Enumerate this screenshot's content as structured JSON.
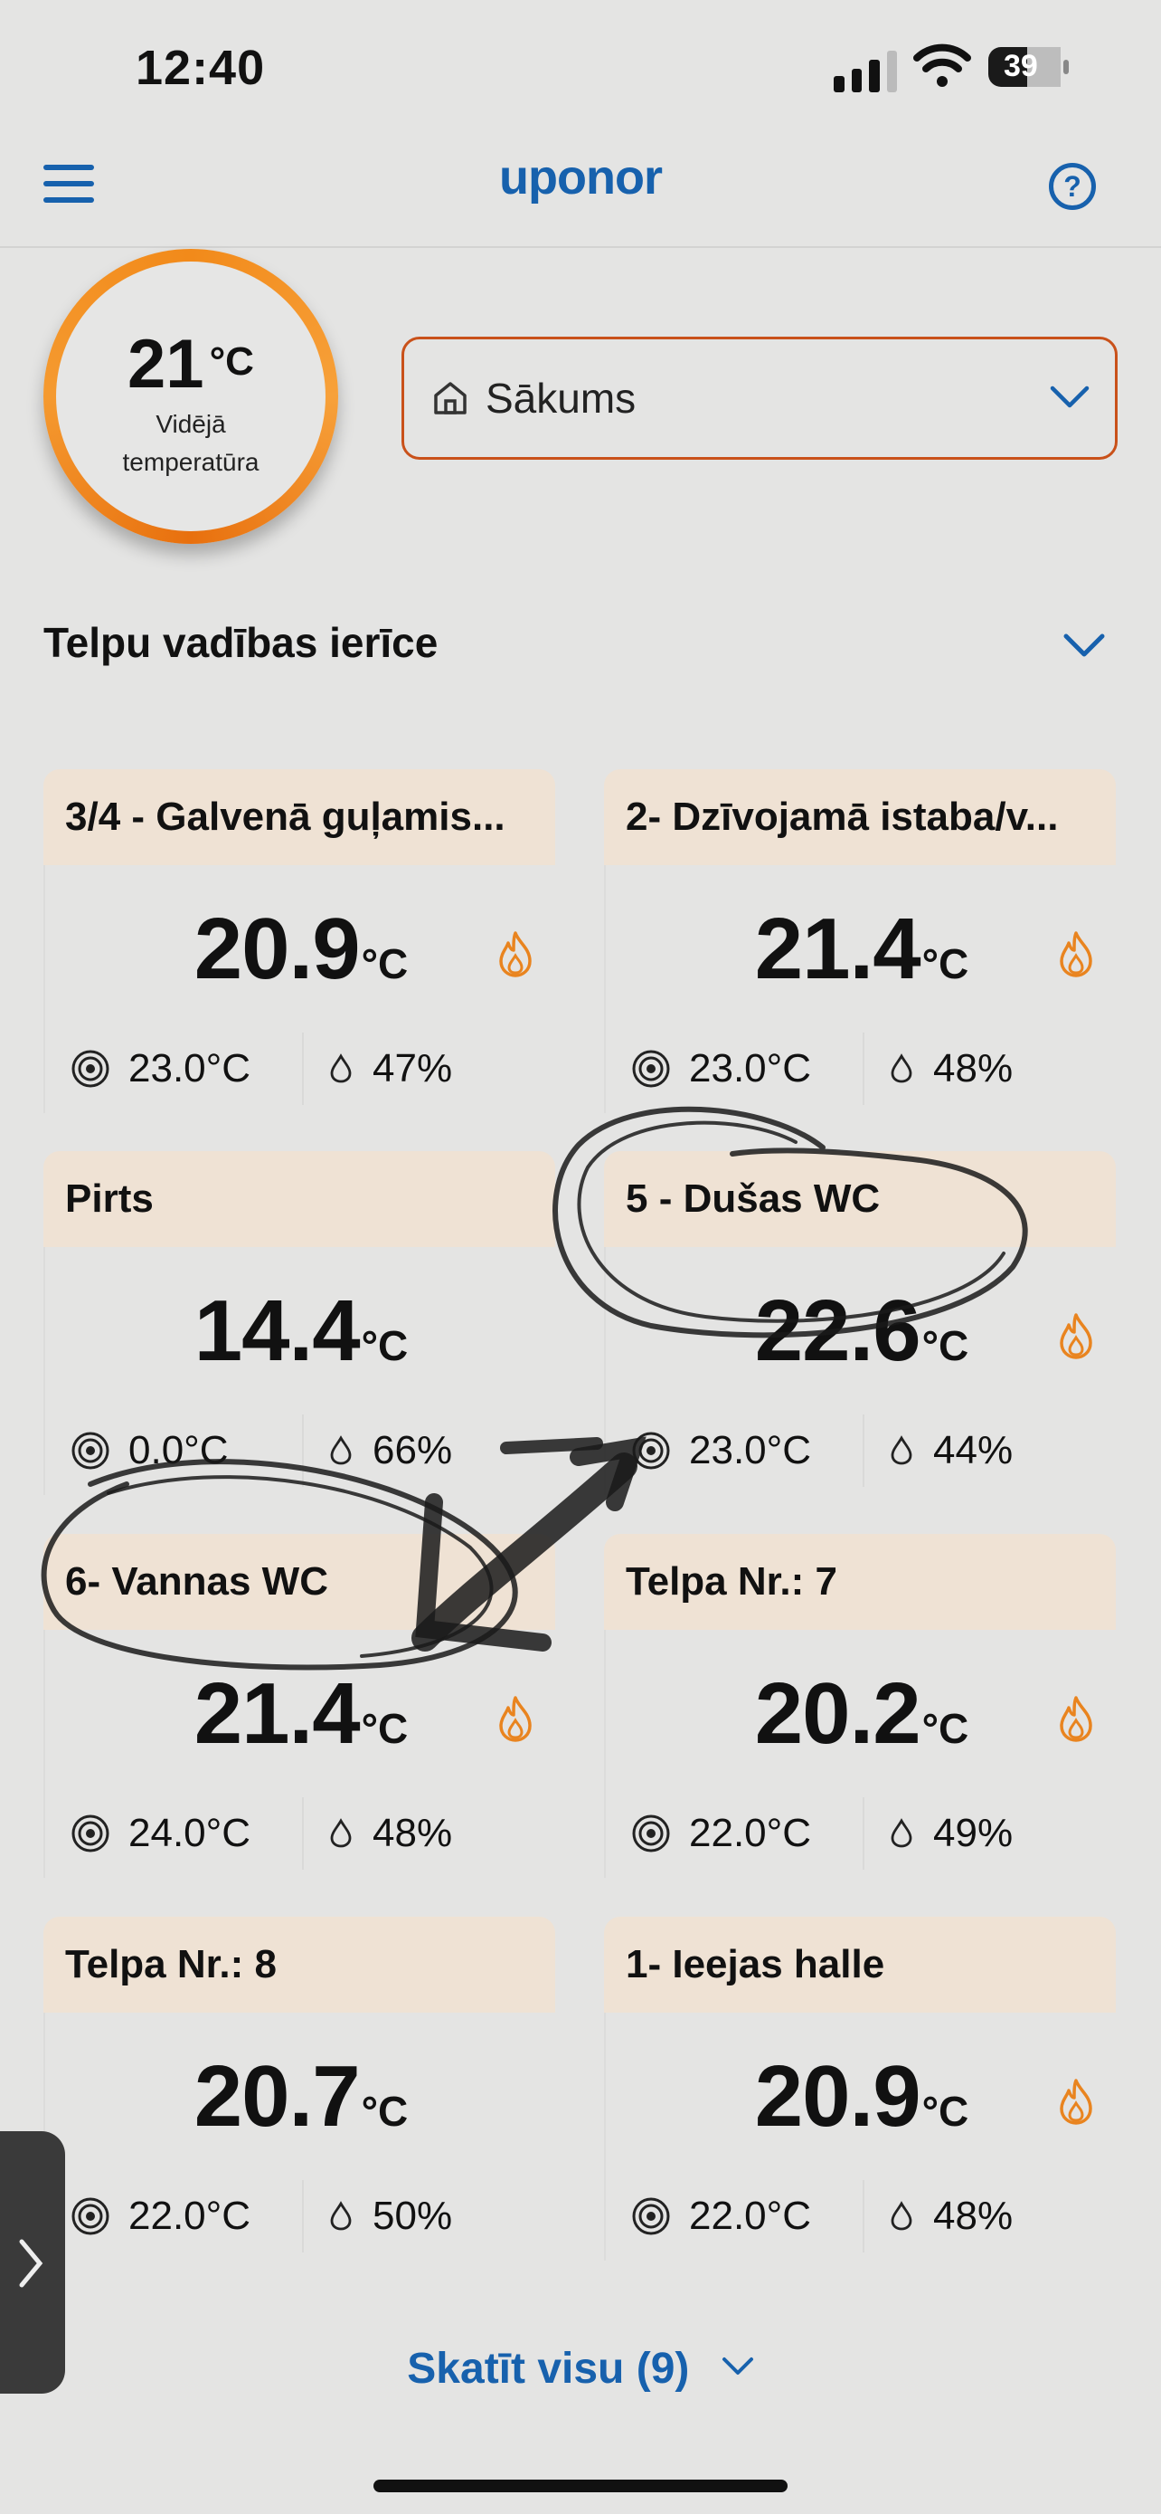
{
  "status_bar": {
    "time": "12:40",
    "battery": "39"
  },
  "header": {
    "logo": "uponor",
    "help_icon": "?"
  },
  "average": {
    "value": "21",
    "unit": "°C",
    "label_line1": "Vidējā",
    "label_line2": "temperatūra",
    "ring_color": "#f28a1a"
  },
  "location": {
    "label": "Sākums",
    "border_color": "#c9511a"
  },
  "section": {
    "title": "Telpu vadības ierīce"
  },
  "accent": "#1761ad",
  "rooms": [
    {
      "name": "3/4 - Galvenā guļamis...",
      "temp": "20.9",
      "unit": "°C",
      "setpoint": "23.0°C",
      "humidity": "47%",
      "heating": true
    },
    {
      "name": "2- Dzīvojamā istaba/v...",
      "temp": "21.4",
      "unit": "°C",
      "setpoint": "23.0°C",
      "humidity": "48%",
      "heating": true
    },
    {
      "name": "Pirts",
      "temp": "14.4",
      "unit": "°C",
      "setpoint": "0.0°C",
      "humidity": "66%",
      "heating": false
    },
    {
      "name": "5 - Dušas WC",
      "temp": "22.6",
      "unit": "°C",
      "setpoint": "23.0°C",
      "humidity": "44%",
      "heating": true
    },
    {
      "name": "6- Vannas WC",
      "temp": "21.4",
      "unit": "°C",
      "setpoint": "24.0°C",
      "humidity": "48%",
      "heating": true
    },
    {
      "name": "Telpa Nr.: 7",
      "temp": "20.2",
      "unit": "°C",
      "setpoint": "22.0°C",
      "humidity": "49%",
      "heating": true
    },
    {
      "name": "Telpa Nr.: 8",
      "temp": "20.7",
      "unit": "°C",
      "setpoint": "22.0°C",
      "humidity": "50%",
      "heating": false
    },
    {
      "name": "1- Ieejas halle",
      "temp": "20.9",
      "unit": "°C",
      "setpoint": "22.0°C",
      "humidity": "48%",
      "heating": true
    }
  ],
  "view_all": {
    "label": "Skatīt visu (9)"
  }
}
